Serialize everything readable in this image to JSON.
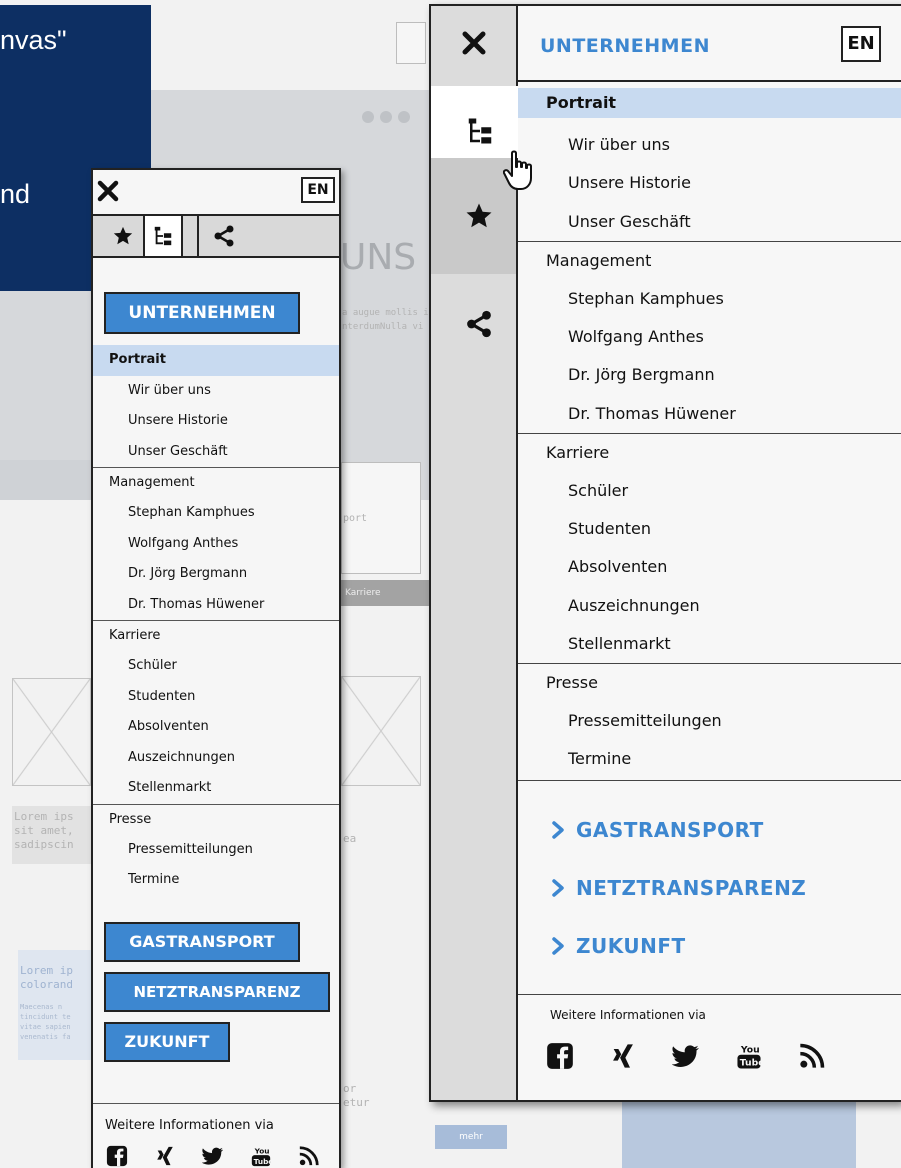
{
  "caption": {
    "line1": "nvas\"",
    "line2": "nd"
  },
  "background": {
    "heading_fragment": "UNS",
    "text1": "a augue mollis ir",
    "text2": "nterdumNulla vi",
    "portrait_fragment": "port",
    "karriere_tab": "Karriere",
    "lorem1": [
      "Lorem ips",
      "sit amet,",
      "sadipscin"
    ],
    "lorem1_right": "ea",
    "lorem2": [
      "Lorem ip",
      "colorand"
    ],
    "lorem2_small": [
      "Maecenas n",
      "tincidunt te",
      "vitae sapien",
      "venenatis fa"
    ],
    "right_fragments": [
      "or",
      "etur"
    ],
    "more_button": "mehr"
  },
  "mobile_menu": {
    "lang": "EN",
    "primary_button": "UNTERNEHMEN",
    "items": [
      {
        "type": "head",
        "label": "Portrait"
      },
      {
        "type": "sub",
        "label": "Wir über uns"
      },
      {
        "type": "sub",
        "label": "Unsere Historie"
      },
      {
        "type": "sub",
        "label": "Unser Geschäft"
      },
      {
        "type": "head",
        "label": "Management"
      },
      {
        "type": "sub",
        "label": "Stephan Kamphues"
      },
      {
        "type": "sub",
        "label": "Wolfgang Anthes"
      },
      {
        "type": "sub",
        "label": "Dr. Jörg Bergmann"
      },
      {
        "type": "sub",
        "label": "Dr. Thomas Hüwener"
      },
      {
        "type": "head",
        "label": "Karriere"
      },
      {
        "type": "sub",
        "label": "Schüler"
      },
      {
        "type": "sub",
        "label": "Studenten"
      },
      {
        "type": "sub",
        "label": "Absolventen"
      },
      {
        "type": "sub",
        "label": "Auszeichnungen"
      },
      {
        "type": "sub",
        "label": "Stellenmarkt"
      },
      {
        "type": "head",
        "label": "Presse"
      },
      {
        "type": "sub",
        "label": "Pressemitteilungen"
      },
      {
        "type": "sub",
        "label": "Termine"
      }
    ],
    "buttons": [
      "GASTRANSPORT",
      "NETZTRANSPARENZ",
      "ZUKUNFT"
    ],
    "more_info": "Weitere Informationen via"
  },
  "desktop_menu": {
    "title": "UNTERNEHMEN",
    "lang": "EN",
    "items": [
      {
        "type": "head",
        "label": "Portrait"
      },
      {
        "type": "sub",
        "label": "Wir über uns"
      },
      {
        "type": "sub",
        "label": "Unsere Historie"
      },
      {
        "type": "sub",
        "label": "Unser Geschäft"
      },
      {
        "type": "head",
        "label": "Management"
      },
      {
        "type": "sub",
        "label": "Stephan Kamphues"
      },
      {
        "type": "sub",
        "label": "Wolfgang Anthes"
      },
      {
        "type": "sub",
        "label": "Dr. Jörg Bergmann"
      },
      {
        "type": "sub",
        "label": "Dr. Thomas Hüwener"
      },
      {
        "type": "head",
        "label": "Karriere"
      },
      {
        "type": "sub",
        "label": "Schüler"
      },
      {
        "type": "sub",
        "label": "Studenten"
      },
      {
        "type": "sub",
        "label": "Absolventen"
      },
      {
        "type": "sub",
        "label": "Auszeichnungen"
      },
      {
        "type": "sub",
        "label": "Stellenmarkt"
      },
      {
        "type": "head",
        "label": "Presse"
      },
      {
        "type": "sub",
        "label": "Pressemitteilungen"
      },
      {
        "type": "sub",
        "label": "Termine"
      }
    ],
    "links": [
      "GASTRANSPORT",
      "NETZTRANSPARENZ",
      "ZUKUNFT"
    ],
    "more_info": "Weitere Informationen via"
  },
  "icons": {
    "close": "close-icon",
    "sitemap": "sitemap-icon",
    "star": "star-icon",
    "share": "share-icon",
    "cursor": "hand-pointer-icon",
    "chevron": "chevron-right-icon",
    "social": [
      "facebook-icon",
      "xing-icon",
      "twitter-icon",
      "youtube-icon",
      "rss-icon"
    ]
  },
  "colors": {
    "accent": "#3d87d0",
    "highlight": "#c8daf0",
    "caption_bg": "#0d2f63"
  }
}
